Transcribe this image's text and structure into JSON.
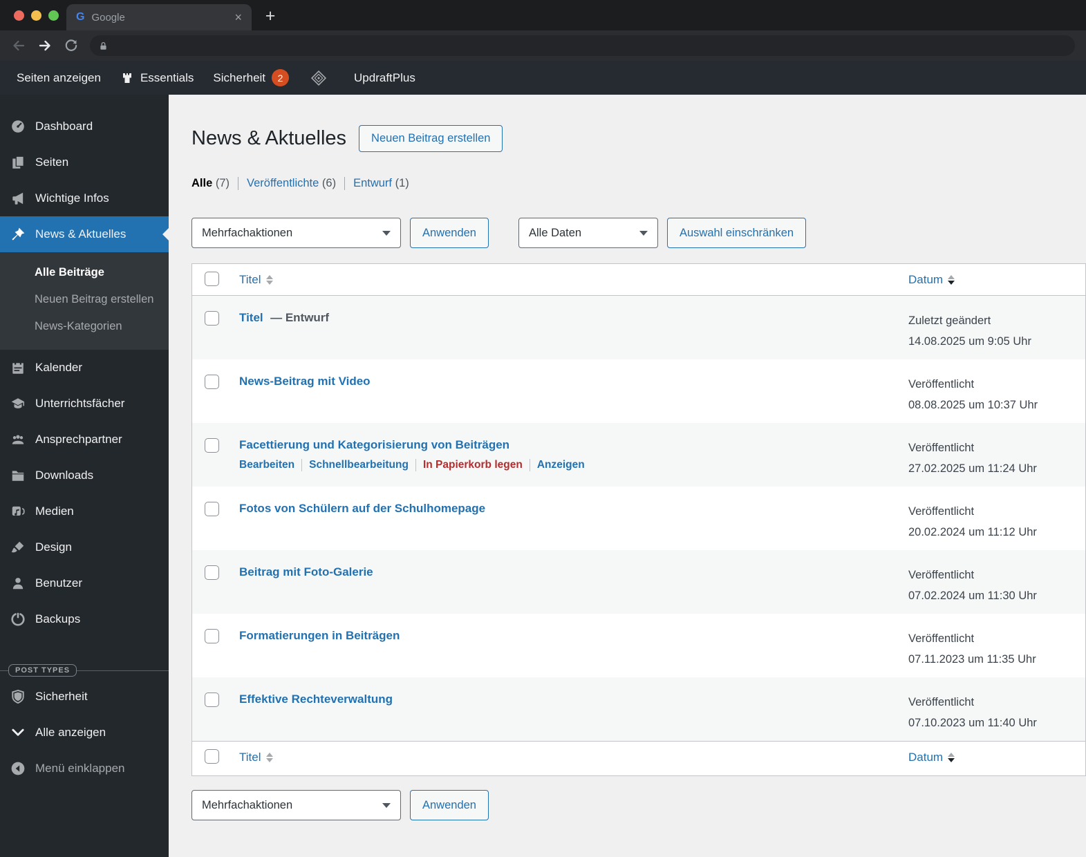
{
  "colors": {
    "accent_blue": "#2271b1",
    "badge_orange": "#d54e21",
    "trash_red": "#b32d2e",
    "sidebar_dark": "#23282d",
    "content_bg": "#f0f0f1"
  },
  "browser": {
    "tab_title": "Google",
    "close_icon": "×",
    "new_tab_icon": "+",
    "favicon_letter": "G"
  },
  "admin_bar": {
    "seiten_anzeigen": "Seiten anzeigen",
    "essentials": "Essentials",
    "sicherheit": "Sicherheit",
    "sicherheit_badge": "2",
    "updraftplus": "UpdraftPlus"
  },
  "sidebar": {
    "items": [
      {
        "label": "Dashboard",
        "icon": "gauge-icon"
      },
      {
        "label": "Seiten",
        "icon": "pages-icon"
      },
      {
        "label": "Wichtige Infos",
        "icon": "megaphone-icon"
      },
      {
        "label": "News & Aktuelles",
        "icon": "pushpin-icon",
        "active": true
      },
      {
        "label": "Kalender",
        "icon": "calendar-icon"
      },
      {
        "label": "Unterrichtsfächer",
        "icon": "graduation-cap-icon"
      },
      {
        "label": "Ansprechpartner",
        "icon": "groups-icon"
      },
      {
        "label": "Downloads",
        "icon": "folder-icon"
      },
      {
        "label": "Medien",
        "icon": "media-icon"
      },
      {
        "label": "Design",
        "icon": "brush-icon"
      },
      {
        "label": "Benutzer",
        "icon": "user-icon"
      },
      {
        "label": "Backups",
        "icon": "backup-icon"
      }
    ],
    "submenu": [
      {
        "label": "Alle Beiträge",
        "current": true
      },
      {
        "label": "Neuen Beitrag erstellen"
      },
      {
        "label": "News-Kategorien"
      }
    ],
    "post_types_label": "POST TYPES",
    "sicherheit": "Sicherheit",
    "alle_anzeigen": "Alle anzeigen",
    "menu_einklappen": "Menü einklappen"
  },
  "main": {
    "page_title": "News & Aktuelles",
    "new_post_button": "Neuen Beitrag erstellen",
    "filters": [
      {
        "label": "Alle",
        "count": "(7)",
        "current": true
      },
      {
        "label": "Veröffentlichte",
        "count": "(6)"
      },
      {
        "label": "Entwurf",
        "count": "(1)"
      }
    ],
    "bulk_select": "Mehrfachaktionen",
    "apply_button": "Anwenden",
    "date_select": "Alle Daten",
    "restrict_button": "Auswahl einschränken",
    "table": {
      "col_title": "Titel",
      "col_date": "Datum",
      "rows": [
        {
          "title": "Titel",
          "state": "— Entwurf",
          "status": "Zuletzt geändert",
          "date": "14.08.2025 um 9:05 Uhr"
        },
        {
          "title": "News-Beitrag mit Video",
          "status": "Veröffentlicht",
          "date": "08.08.2025 um 10:37 Uhr"
        },
        {
          "title": "Facettierung und Kategorisierung von Beiträgen",
          "status": "Veröffentlicht",
          "date": "27.02.2025 um 11:24 Uhr",
          "actions": {
            "edit": "Bearbeiten",
            "quick": "Schnellbearbeitung",
            "trash": "In Papierkorb legen",
            "view": "Anzeigen"
          }
        },
        {
          "title": "Fotos von Schülern auf der Schulhomepage",
          "status": "Veröffentlicht",
          "date": "20.02.2024 um 11:12 Uhr"
        },
        {
          "title": "Beitrag mit Foto-Galerie",
          "status": "Veröffentlicht",
          "date": "07.02.2024 um 11:30 Uhr"
        },
        {
          "title": "Formatierungen in Beiträgen",
          "status": "Veröffentlicht",
          "date": "07.11.2023 um 11:35 Uhr"
        },
        {
          "title": "Effektive Rechteverwaltung",
          "status": "Veröffentlicht",
          "date": "07.10.2023 um 11:40 Uhr"
        }
      ]
    },
    "bottom": {
      "bulk_select": "Mehrfachaktionen",
      "apply_button": "Anwenden"
    }
  }
}
